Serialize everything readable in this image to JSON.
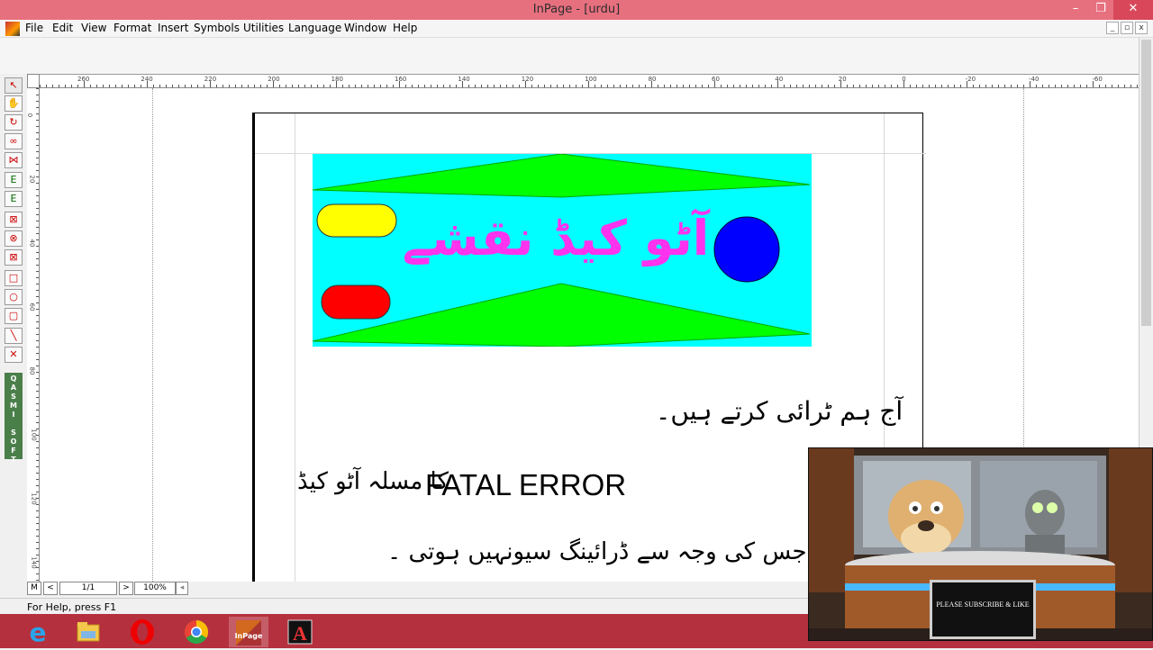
{
  "window": {
    "title": "InPage - [urdu]",
    "minimize": "–",
    "restore": "❐",
    "close": "✕"
  },
  "menu": {
    "items": [
      "File",
      "Edit",
      "View",
      "Format",
      "Insert",
      "Symbols",
      "Utilities",
      "Language",
      "Window",
      "Help"
    ],
    "doc_controls": [
      "_",
      "▫",
      "x"
    ]
  },
  "ruler": {
    "horizontal_labels": [
      "260",
      "240",
      "220",
      "200",
      "180",
      "160",
      "140",
      "120",
      "100",
      "80",
      "60",
      "40",
      "20",
      "0",
      "-20",
      "-40",
      "-60"
    ],
    "vertical_labels": [
      "0",
      "20",
      "40",
      "60",
      "80",
      "100",
      "120",
      "140"
    ]
  },
  "toolbox": {
    "tools": [
      "pointer-icon",
      "hand-icon",
      "rotate-icon",
      "link-icon",
      "unlink-icon",
      "text-frame-icon",
      "text-frame-2-icon",
      "picture-box-icon",
      "picture-oval-icon",
      "picture-box-2-icon",
      "rectangle-icon",
      "oval-icon",
      "rounded-rect-icon",
      "line-icon",
      "cross-icon"
    ],
    "brand": "QASMI SOFT"
  },
  "document": {
    "banner": {
      "heading": "آٹو کیڈ نقشے",
      "colors": {
        "background": "#00ffff",
        "triangles": "#00ff00",
        "text": "#ff33ee",
        "pill_top": "#ffff00",
        "pill_bottom": "#ff0000",
        "circle": "#0000ff"
      }
    },
    "line1": "آج ہم ٹرائی کرتے ہیں۔",
    "line2_urdu": "کا مسلہ آٹو کیڈ",
    "line2_english": "FATAL ERROR",
    "line3": "سلہ ہے۔ جس کی وجہ سے ڈرائینگ سیونہیں ہوتی ۔"
  },
  "navigation": {
    "master": "M",
    "prev": "<",
    "page": "1/1",
    "next": ">",
    "zoom": "100%",
    "scroll_left": "◂"
  },
  "status": {
    "help_text": "For Help, press F1"
  },
  "taskbar": {
    "apps": [
      "internet-explorer-icon",
      "file-explorer-icon",
      "opera-icon",
      "chrome-icon",
      "inpage-icon",
      "autocad-icon"
    ],
    "active_app": "InPage"
  },
  "overlay": {
    "sign_text": "PLEASE SUBSCRIBE & LIKE"
  }
}
